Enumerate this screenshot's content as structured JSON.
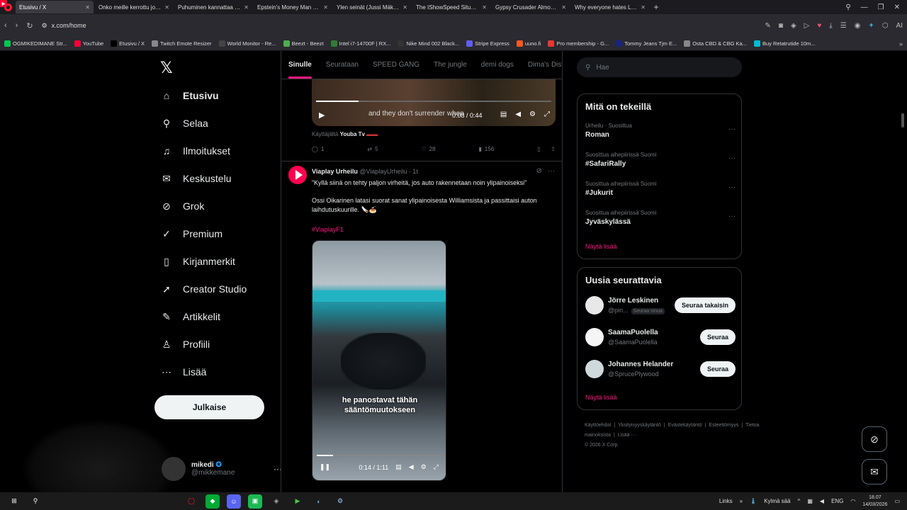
{
  "browser": {
    "tabs": [
      {
        "title": "Etusivu / X",
        "fav": "X",
        "type": "x",
        "active": true
      },
      {
        "title": "Onko meille kerrottu jo ka",
        "fav": "▶",
        "type": "yt",
        "active": false
      },
      {
        "title": "Puhuminen kannattaa ain",
        "fav": "▶",
        "type": "yt",
        "active": false
      },
      {
        "title": "Epstein's Money Man Spil",
        "fav": "▶",
        "type": "yt",
        "active": false
      },
      {
        "title": "Ylen seinät (Jussi Mäkinen",
        "fav": "▶",
        "type": "yt",
        "active": false
      },
      {
        "title": "The IShowSpeed Situation",
        "fav": "▶",
        "type": "yt",
        "active": false
      },
      {
        "title": "Gypsy Crusader Almost P",
        "fav": "▶",
        "type": "yt",
        "active": false
      },
      {
        "title": "Why everyone hates Lego",
        "fav": "▶",
        "type": "yt",
        "active": false
      }
    ],
    "url": "x.com/home",
    "bookmarks": [
      {
        "label": "OGMIKEDIMANE Str...",
        "color": "#00c853"
      },
      {
        "label": "YouTube",
        "color": "#ff0033"
      },
      {
        "label": "Etusivu / X",
        "color": "#000000"
      },
      {
        "label": "Twitch Emote Resizer",
        "color": "#888888"
      },
      {
        "label": "World Monitor - Re...",
        "color": "#444444"
      },
      {
        "label": "Beezt - Beezt",
        "color": "#4caf50"
      },
      {
        "label": "Intel i7-14700F | RX...",
        "color": "#2e7d32"
      },
      {
        "label": "Nike Mind 002 Black...",
        "color": "#333333"
      },
      {
        "label": "Stripe Express",
        "color": "#635bff"
      },
      {
        "label": "uuno.fi",
        "color": "#ff5722"
      },
      {
        "label": "Pro membership - G...",
        "color": "#e53935"
      },
      {
        "label": "Tommy Jeans Tjm E...",
        "color": "#1a237e"
      },
      {
        "label": "Osta CBD & CBG Ka...",
        "color": "#888888"
      },
      {
        "label": "Buy Retatrutide 10m...",
        "color": "#00bcd4"
      }
    ]
  },
  "nav": {
    "items": [
      {
        "label": "Etusivu",
        "icon": "home-icon",
        "glyph": "⌂"
      },
      {
        "label": "Selaa",
        "icon": "search-icon",
        "glyph": "⚲"
      },
      {
        "label": "Ilmoitukset",
        "icon": "bell-icon",
        "glyph": "♫"
      },
      {
        "label": "Keskustelu",
        "icon": "mail-icon",
        "glyph": "✉"
      },
      {
        "label": "Grok",
        "icon": "grok-icon",
        "glyph": "⊘"
      },
      {
        "label": "Premium",
        "icon": "premium-icon",
        "glyph": "✓"
      },
      {
        "label": "Kirjanmerkit",
        "icon": "bookmark-icon",
        "glyph": "▯"
      },
      {
        "label": "Creator Studio",
        "icon": "rocket-icon",
        "glyph": "➚"
      },
      {
        "label": "Artikkelit",
        "icon": "article-icon",
        "glyph": "✎"
      },
      {
        "label": "Profiili",
        "icon": "person-icon",
        "glyph": "♙"
      },
      {
        "label": "Lisää",
        "icon": "more-icon",
        "glyph": "⋯"
      }
    ],
    "post_button": "Julkaise",
    "profile": {
      "name": "mikedi",
      "handle": "@mikkemane"
    }
  },
  "feed": {
    "tabs": [
      "Sinulle",
      "Seurataan",
      "SPEED GANG",
      "The jungle",
      "demi dogs",
      "Dima's Dist"
    ],
    "tweet1": {
      "caption": "and they don't surrender when",
      "time": "0:08 / 0:44",
      "progress": 0.18,
      "byline_prefix": "Käyttäjältä",
      "byline_name": "Youba Tv",
      "stats": {
        "replies": "1",
        "reposts": "5",
        "likes": "28",
        "views": "156"
      }
    },
    "tweet2": {
      "name": "Viaplay Urheilu",
      "handle": "@ViaplayUrheilu · 1t",
      "text1": "”Kyllä siinä on tehty paljon virheitä, jos auto rakennetaan noin ylipainoiseksi”",
      "text2": "Ossi Oikarinen latasi suorat sanat ylipainoisesta Williamsista ja passittaisi auton laihdutuskuurille. 🪚🍝",
      "hashtag": "#ViaplayF1",
      "video_caption_1": "he panostavat tähän",
      "video_caption_2": "sääntömuutokseen",
      "time": "0:14 / 1:11",
      "progress": 0.13
    }
  },
  "sidebar": {
    "search_placeholder": "Hae",
    "trends_title": "Mitä on tekeillä",
    "trends": [
      {
        "context": "Urheilu · Suosittua",
        "name": "Roman"
      },
      {
        "context": "Suosittua aihepiirissä Suomi",
        "name": "#SafariRally"
      },
      {
        "context": "Suosittua aihepiirissä Suomi",
        "name": "#Jukurit"
      },
      {
        "context": "Suosittua aihepiirissä Suomi",
        "name": "Jyväskylässä"
      }
    ],
    "show_more": "Näytä lisää",
    "follow_title": "Uusia seurattavia",
    "follows": [
      {
        "name": "Jörre Leskinen",
        "handle": "@pin...",
        "badge": "Seuraa sinua",
        "button": "Seuraa takaisin"
      },
      {
        "name": "SaamaPuolella",
        "handle": "@SaamaPuolella",
        "badge": "",
        "button": "Seuraa"
      },
      {
        "name": "Johannes Helander",
        "handle": "@SprucePlywood",
        "badge": "",
        "button": "Seuraa"
      }
    ],
    "footer_links": [
      "Käyttöehdot",
      "Yksityisyyskäytäntö",
      "Evästekäytäntö",
      "Esteettömyys",
      "Tietoa mainoksista",
      "Lisää ···"
    ],
    "copyright": "© 2026 X Corp."
  },
  "taskbar": {
    "links": "Links",
    "weather": "Kylmä sää",
    "lang": "ENG",
    "time": "18.07",
    "date": "14/03/2026"
  }
}
